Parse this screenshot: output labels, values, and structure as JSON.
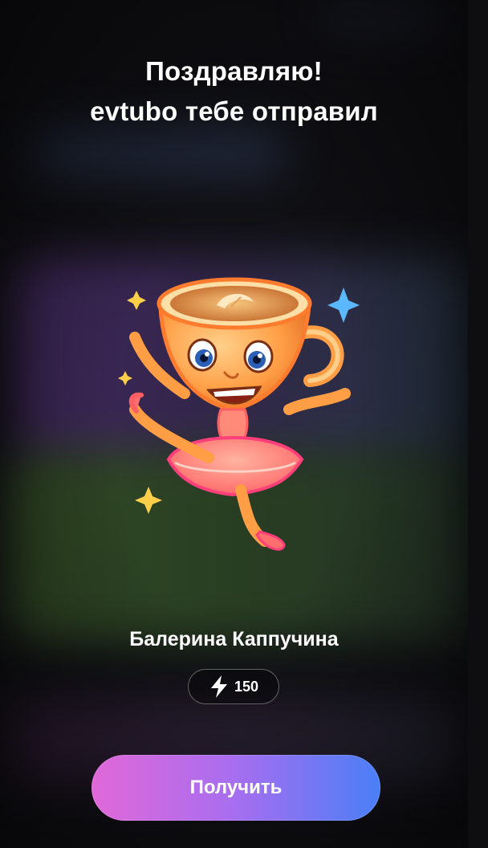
{
  "header": {
    "title_line1": "Поздравляю!",
    "title_line2": "evtubo тебе отправил"
  },
  "gift": {
    "name": "Балерина Каппучина",
    "icon": "cappuccino-ballerina-sticker",
    "price_icon": "lightning-icon",
    "price": "150"
  },
  "actions": {
    "receive_label": "Получить"
  },
  "colors": {
    "button_gradient_start": "#e168d8",
    "button_gradient_mid": "#a66ef0",
    "button_gradient_end": "#4a7ff6",
    "background": "#101014"
  }
}
